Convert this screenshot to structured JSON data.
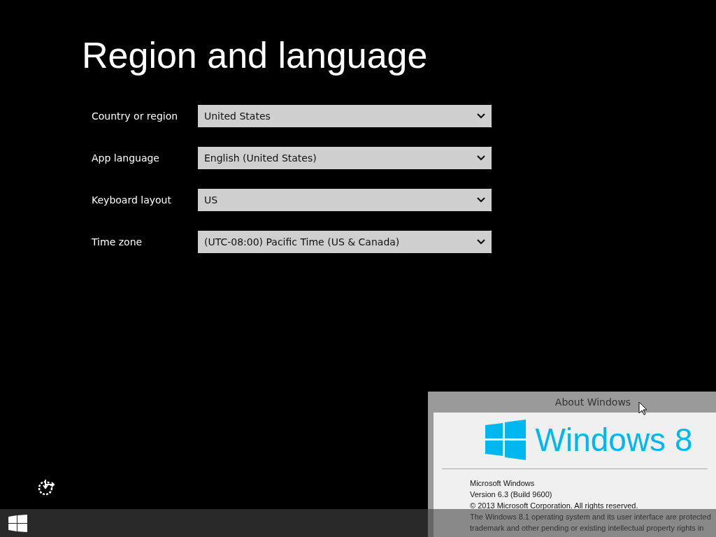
{
  "title": "Region and language",
  "settings": [
    {
      "label": "Country or region",
      "value": "United States"
    },
    {
      "label": "App language",
      "value": "English (United States)"
    },
    {
      "label": "Keyboard layout",
      "value": "US"
    },
    {
      "label": "Time zone",
      "value": "(UTC-08:00) Pacific Time (US & Canada)"
    }
  ],
  "about_window": {
    "title": "About Windows",
    "logo_text": "Windows 8",
    "lines": [
      "Microsoft Windows",
      "Version 6.3 (Build 9600)",
      "© 2013 Microsoft Corporation. All rights reserved.",
      "The Windows 8.1 operating system and its user interface are protected",
      "trademark and other pending or existing intellectual property rights in"
    ]
  }
}
